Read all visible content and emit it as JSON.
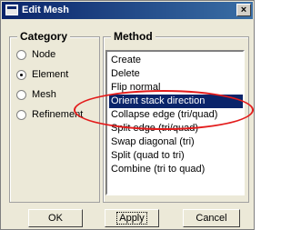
{
  "window": {
    "title": "Edit Mesh",
    "close_label": "×"
  },
  "category": {
    "title": "Category",
    "options": [
      {
        "label": "Node",
        "selected": false
      },
      {
        "label": "Element",
        "selected": true
      },
      {
        "label": "Mesh",
        "selected": false
      },
      {
        "label": "Refinement",
        "selected": false
      }
    ]
  },
  "method": {
    "title": "Method",
    "items": [
      {
        "label": "Create",
        "selected": false
      },
      {
        "label": "Delete",
        "selected": false
      },
      {
        "label": "Flip normal",
        "selected": false
      },
      {
        "label": "Orient stack direction",
        "selected": true
      },
      {
        "label": "Collapse edge (tri/quad)",
        "selected": false
      },
      {
        "label": "Split edge (tri/quad)",
        "selected": false
      },
      {
        "label": "Swap diagonal (tri)",
        "selected": false
      },
      {
        "label": "Split (quad to tri)",
        "selected": false
      },
      {
        "label": "Combine (tri to quad)",
        "selected": false
      }
    ]
  },
  "buttons": {
    "ok": "OK",
    "apply": "Apply",
    "cancel": "Cancel"
  },
  "colors": {
    "highlight": "#0a246a",
    "annotation": "#e31c1c"
  }
}
